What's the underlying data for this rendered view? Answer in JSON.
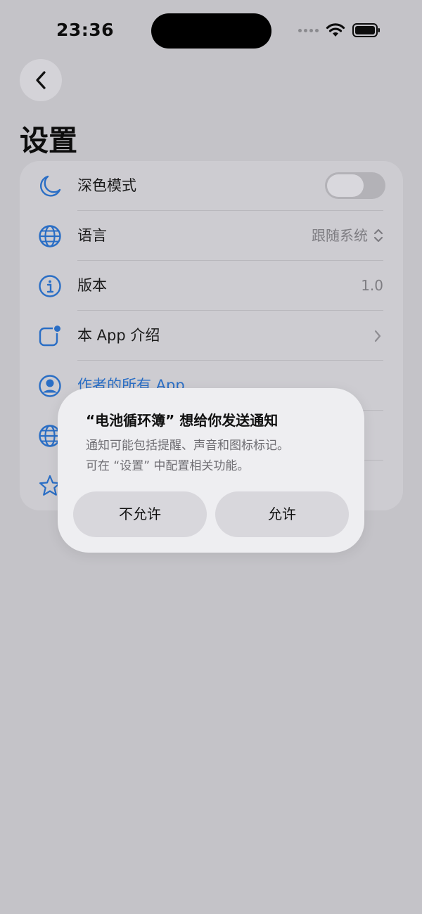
{
  "status_bar": {
    "time": "23:36"
  },
  "header": {
    "title": "设置"
  },
  "settings": {
    "rows": [
      {
        "label": "深色模式",
        "icon": "moon-icon"
      },
      {
        "label": "语言",
        "value": "跟随系统",
        "icon": "globe-icon"
      },
      {
        "label": "版本",
        "value": "1.0",
        "icon": "info-icon"
      },
      {
        "label": "本 App 介绍",
        "icon": "app-badge-icon"
      },
      {
        "label": "作者的所有 App",
        "icon": "person-circle-icon"
      },
      {
        "label": "",
        "icon": "globe-icon"
      },
      {
        "label": "",
        "icon": "star-icon"
      }
    ],
    "dark_mode_on": false
  },
  "alert": {
    "title": "“电池循环簿” 想给你发送通知",
    "message_line1": "通知可能包括提醒、声音和图标标记。",
    "message_line2": "可在 “设置” 中配置相关功能。",
    "deny_label": "不允许",
    "allow_label": "允许"
  },
  "colors": {
    "accent": "#2a6ec5",
    "background": "#c4c3c8",
    "card": "#cdccd1",
    "alert_bg": "#eeeef1"
  }
}
